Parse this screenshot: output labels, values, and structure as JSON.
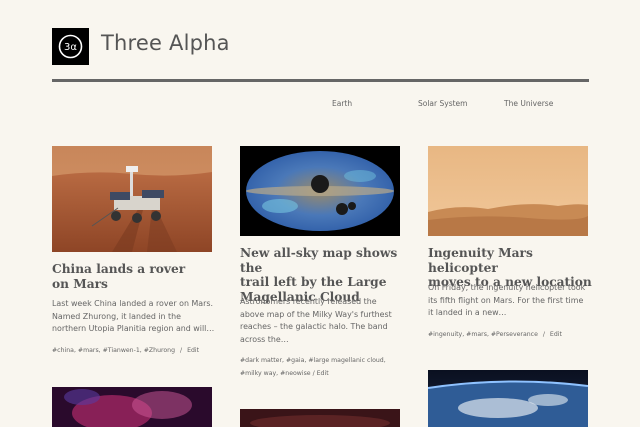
{
  "site": {
    "title": "Three Alpha",
    "logo_text": "3α"
  },
  "nav": [
    "Earth",
    "Solar System",
    "The Universe"
  ],
  "posts": [
    {
      "title_lines": [
        "China lands a rover",
        "on Mars"
      ],
      "excerpt_lines": [
        "Last week China landed a rover on Mars.",
        "Named Zhurong, it landed in the",
        "northern Utopia Planitia region and will…"
      ],
      "tags": [
        "#china",
        "#mars",
        "#Tianwen-1",
        "#Zhurong"
      ],
      "edit": "Edit"
    },
    {
      "title_lines": [
        "New all-sky map shows the",
        "trail left by the Large",
        "Magellanic Cloud"
      ],
      "excerpt_lines": [
        "Astronomers recently released the",
        "above map of the Milky Way's furthest",
        "reaches – the galactic halo. The band",
        "across the…"
      ],
      "tags_line1": [
        "#dark matter",
        "#gaia",
        "#large magellanic cloud"
      ],
      "tags_line2": [
        "#milky way",
        "#neowise"
      ],
      "edit": "Edit"
    },
    {
      "title_lines": [
        "Ingenuity Mars helicopter",
        "moves to a new location"
      ],
      "excerpt_lines": [
        "On Friday, the Ingenuity helicopter took",
        "its fifth flight on Mars. For the first time",
        "it landed in a new…"
      ],
      "tags": [
        "#ingenuity",
        "#mars",
        "#Perseverance"
      ],
      "edit": "Edit"
    }
  ],
  "colors": {
    "background": "#f9f6ef",
    "rule": "#666666",
    "text": "#555555"
  }
}
